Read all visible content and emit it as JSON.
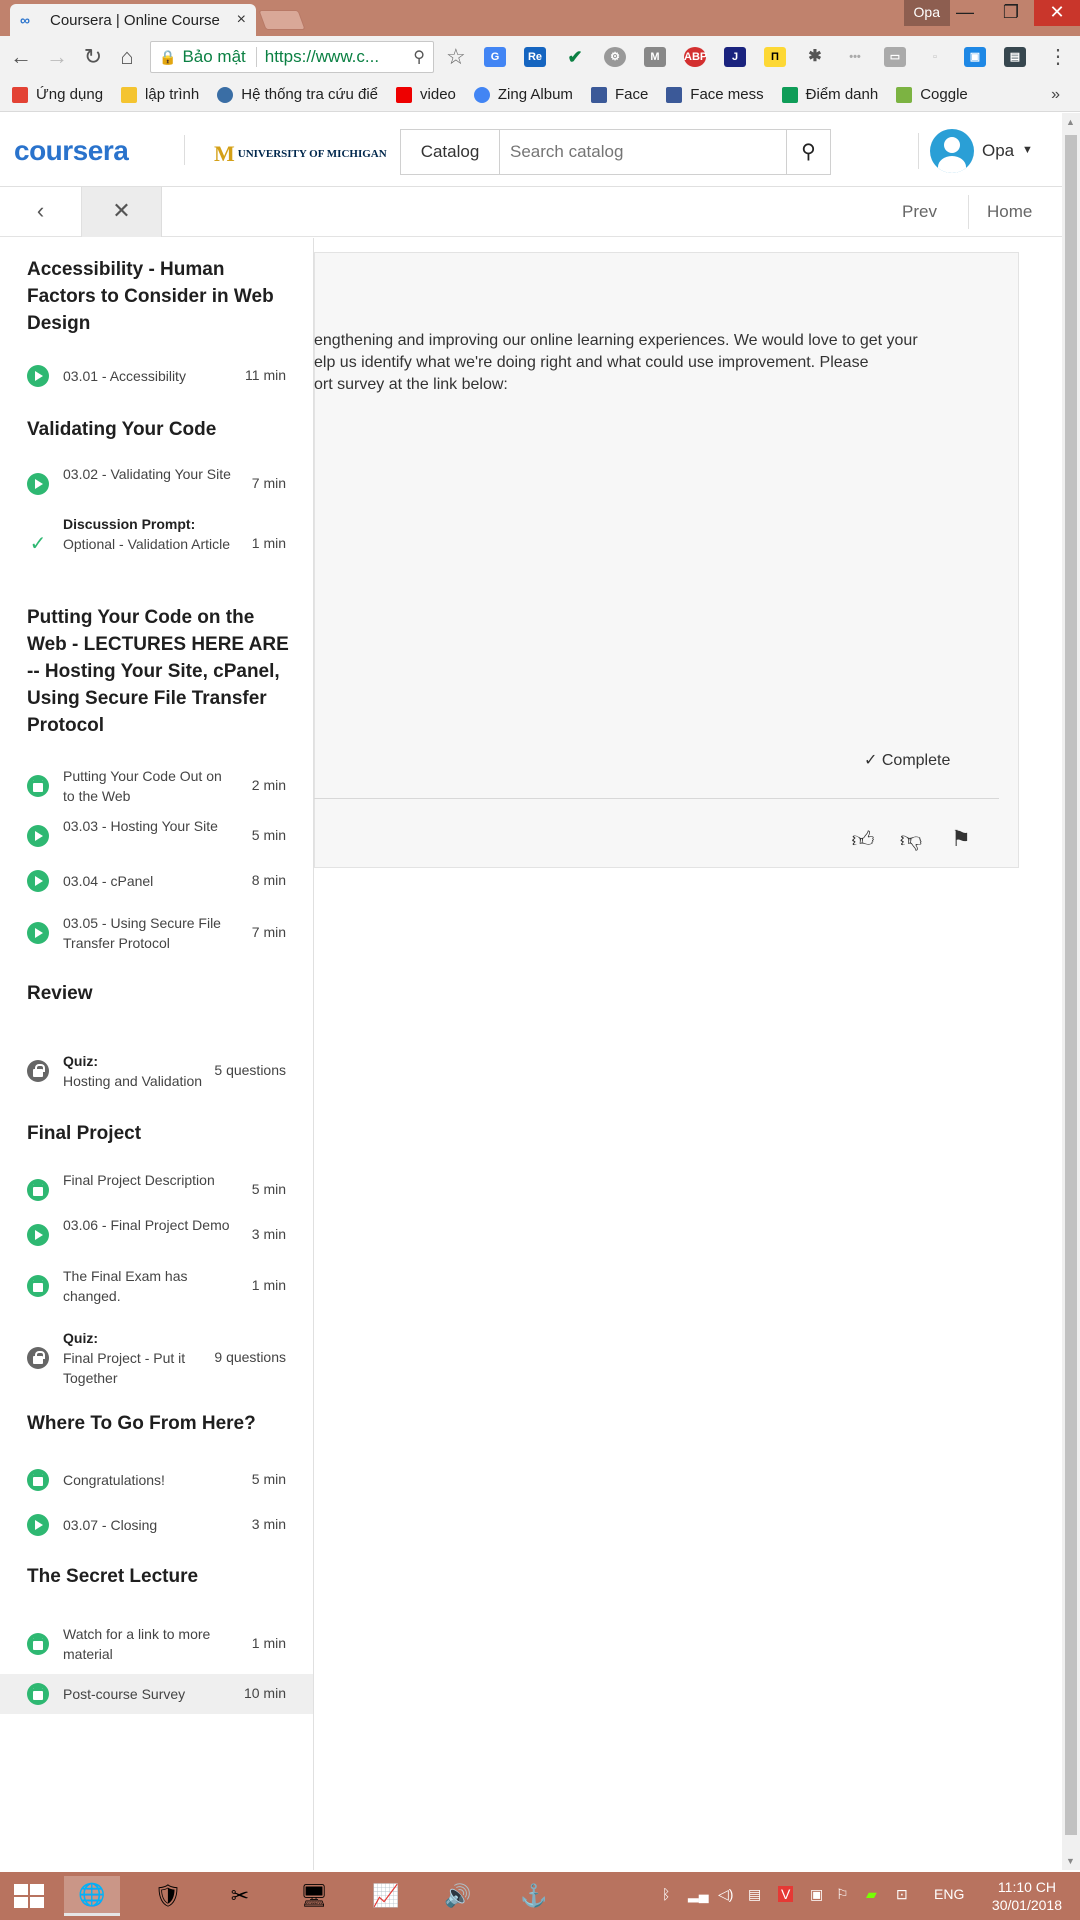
{
  "browser": {
    "tab_title": "Coursera | Online Course",
    "tab_favicon": "∞",
    "tab_close": "×",
    "profile": "Opa",
    "secure_label": "Bảo mật",
    "url": "https://www.c...",
    "bookmarks": [
      {
        "label": "Ứng dụng",
        "color": "#e34234"
      },
      {
        "label": "lập trình",
        "color": "#f4c430"
      },
      {
        "label": "Hệ thống tra cứu điể",
        "color": "#3a6ea5"
      },
      {
        "label": "video",
        "color": "#e00"
      },
      {
        "label": "Zing Album",
        "color": "#4285f4"
      },
      {
        "label": "Face",
        "color": "#3b5998"
      },
      {
        "label": "Face mess",
        "color": "#3b5998"
      },
      {
        "label": "Điểm danh",
        "color": "#0f9d58"
      },
      {
        "label": "Coggle",
        "color": "#7cb342"
      }
    ],
    "bookmarks_more": "»"
  },
  "header": {
    "logo": "coursera",
    "partner": "UNIVERSITY OF MICHIGAN",
    "catalog_label": "Catalog",
    "search_placeholder": "Search catalog",
    "username": "Opa"
  },
  "subnav": {
    "prev": "Prev",
    "home": "Home"
  },
  "content": {
    "lines": [
      "engthening and improving our online learning experiences. We would love to get your",
      "elp us identify what we're doing right and what could use improvement. Please",
      "ort survey at the link below:"
    ],
    "complete_label": "Complete"
  },
  "sidebar": {
    "sections": [
      {
        "title": "Accessibility - Human Factors to Consider in Web Design"
      },
      {
        "title": "Validating Your Code"
      },
      {
        "title": "Putting Your Code on the Web - LECTURES HERE ARE -- Hosting Your Site, cPanel, Using Secure File Transfer Protocol"
      },
      {
        "title": "Review"
      },
      {
        "title": "Final Project"
      },
      {
        "title": "Where To Go From Here?"
      },
      {
        "title": "The Secret Lecture"
      }
    ],
    "items": [
      {
        "prefix": "",
        "label": "03.01 - Accessibility",
        "duration": "11 min",
        "icon": "play"
      },
      {
        "prefix": "",
        "label": "03.02 - Validating Your Site",
        "duration": "7 min",
        "icon": "play"
      },
      {
        "prefix": "Discussion Prompt:",
        "label": "Optional - Validation Article",
        "duration": "1 min",
        "icon": "check"
      },
      {
        "prefix": "",
        "label": "Putting Your Code Out on to the Web",
        "duration": "2 min",
        "icon": "read"
      },
      {
        "prefix": "",
        "label": "03.03 - Hosting Your Site",
        "duration": "5 min",
        "icon": "play"
      },
      {
        "prefix": "",
        "label": "03.04 - cPanel",
        "duration": "8 min",
        "icon": "play"
      },
      {
        "prefix": "",
        "label": "03.05 - Using Secure File Transfer Protocol",
        "duration": "7 min",
        "icon": "play"
      },
      {
        "prefix": "Quiz:",
        "label": "Hosting and Validation",
        "duration": "5 questions",
        "icon": "lock"
      },
      {
        "prefix": "",
        "label": "Final Project Description",
        "duration": "5 min",
        "icon": "read"
      },
      {
        "prefix": "",
        "label": "03.06 - Final Project Demo",
        "duration": "3 min",
        "icon": "play"
      },
      {
        "prefix": "",
        "label": "The Final Exam has changed.",
        "duration": "1 min",
        "icon": "read"
      },
      {
        "prefix": "Quiz:",
        "label": "Final Project - Put it Together",
        "duration": "9 questions",
        "icon": "lock"
      },
      {
        "prefix": "",
        "label": "Congratulations!",
        "duration": "5 min",
        "icon": "read"
      },
      {
        "prefix": "",
        "label": "03.07 - Closing",
        "duration": "3 min",
        "icon": "play"
      },
      {
        "prefix": "",
        "label": "Watch for a link to more material",
        "duration": "1 min",
        "icon": "read"
      },
      {
        "prefix": "",
        "label": "Post-course Survey",
        "duration": "10 min",
        "icon": "read"
      }
    ]
  },
  "taskbar": {
    "language": "ENG",
    "time": "11:10 CH",
    "date": "30/01/2018"
  }
}
